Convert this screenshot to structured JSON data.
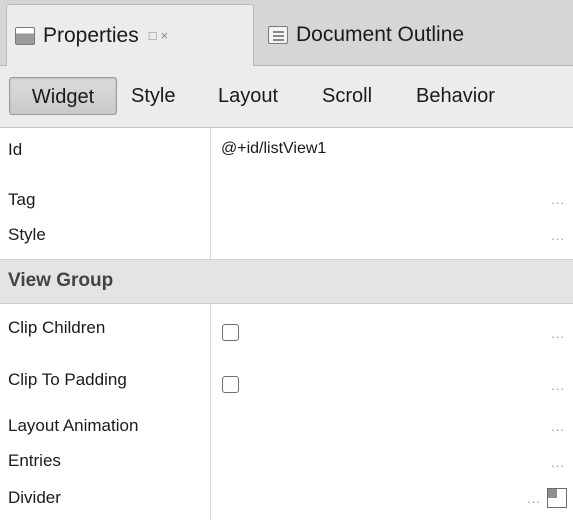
{
  "tabs": {
    "properties": {
      "label": "Properties",
      "icon": "properties-icon",
      "min_glyph": "□",
      "close_glyph": "×"
    },
    "outline": {
      "label": "Document Outline",
      "icon": "outline-icon"
    }
  },
  "categories": [
    "Widget",
    "Style",
    "Layout",
    "Scroll",
    "Behavior"
  ],
  "selected_category": "Widget",
  "properties": [
    {
      "name": "Id",
      "value": "@+id/listView1"
    },
    {
      "name": "Tag",
      "value": ""
    },
    {
      "name": "Style",
      "value": ""
    }
  ],
  "section": {
    "title": "View Group"
  },
  "group_properties": [
    {
      "name": "Clip Children",
      "checked": false
    },
    {
      "name": "Clip To Padding",
      "checked": false
    },
    {
      "name": "Layout Animation",
      "value": ""
    },
    {
      "name": "Entries",
      "value": ""
    },
    {
      "name": "Divider",
      "value": ""
    }
  ],
  "ellipsis": "..."
}
